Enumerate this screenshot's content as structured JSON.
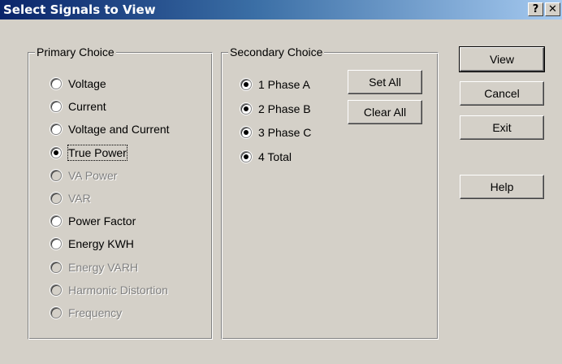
{
  "window": {
    "title": "Select Signals to View",
    "help_glyph": "?",
    "close_glyph": "✕"
  },
  "primary": {
    "label": "Primary Choice",
    "options": [
      {
        "label": "Voltage",
        "checked": false,
        "disabled": false
      },
      {
        "label": "Current",
        "checked": false,
        "disabled": false
      },
      {
        "label": "Voltage and Current",
        "checked": false,
        "disabled": false
      },
      {
        "label": "True Power",
        "checked": true,
        "disabled": false
      },
      {
        "label": "VA Power",
        "checked": false,
        "disabled": true
      },
      {
        "label": "VAR",
        "checked": false,
        "disabled": true
      },
      {
        "label": "Power Factor",
        "checked": false,
        "disabled": false
      },
      {
        "label": "Energy KWH",
        "checked": false,
        "disabled": false
      },
      {
        "label": "Energy VARH",
        "checked": false,
        "disabled": true
      },
      {
        "label": "Harmonic Distortion",
        "checked": false,
        "disabled": true
      },
      {
        "label": "Frequency",
        "checked": false,
        "disabled": true
      }
    ]
  },
  "secondary": {
    "label": "Secondary Choice",
    "options": [
      {
        "label": "1 Phase A",
        "checked": true
      },
      {
        "label": "2 Phase B",
        "checked": true
      },
      {
        "label": "3 Phase C",
        "checked": true
      },
      {
        "label": "4 Total",
        "checked": true
      }
    ],
    "set_all": "Set All",
    "clear_all": "Clear All"
  },
  "buttons": {
    "view": "View",
    "cancel": "Cancel",
    "exit": "Exit",
    "help": "Help"
  }
}
